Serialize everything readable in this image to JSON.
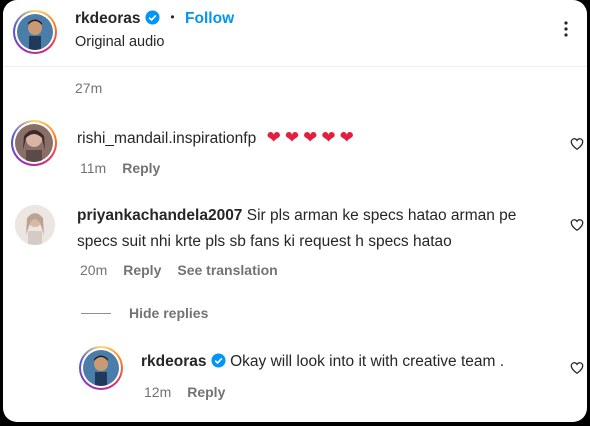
{
  "header": {
    "username": "rkdeoras",
    "follow_label": "Follow",
    "subtitle": "Original audio"
  },
  "caption": {
    "time": "27m"
  },
  "comments": [
    {
      "username": "rishi_mandail.inspirationfp",
      "text": "❤❤❤❤❤",
      "time": "11m",
      "reply_label": "Reply"
    },
    {
      "username": "priyankachandela2007",
      "text_line1": "Sir pls arman ke specs hatao arman pe",
      "text_line2": "specs suit nhi krte pls sb fans ki request h specs hatao",
      "time": "20m",
      "reply_label": "Reply",
      "translate_label": "See translation"
    }
  ],
  "hide_replies_label": "Hide replies",
  "reply": {
    "username": "rkdeoras",
    "text": "Okay will look into it with creative team .",
    "time": "12m",
    "reply_label": "Reply"
  },
  "colors": {
    "follow": "#0095f6",
    "verified": "#0095f6",
    "heart": "#e41e3f"
  },
  "icons": [
    "more-options-icon",
    "verified-badge-icon",
    "like-heart-icon"
  ]
}
